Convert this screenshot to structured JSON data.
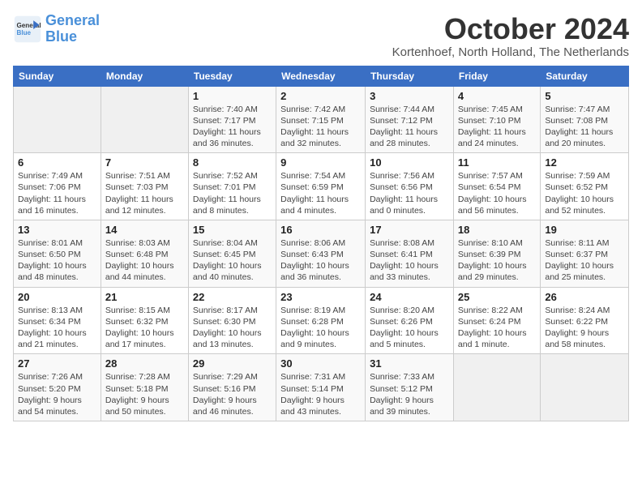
{
  "header": {
    "logo_general": "General",
    "logo_blue": "Blue",
    "month": "October 2024",
    "location": "Kortenhoef, North Holland, The Netherlands"
  },
  "days_of_week": [
    "Sunday",
    "Monday",
    "Tuesday",
    "Wednesday",
    "Thursday",
    "Friday",
    "Saturday"
  ],
  "weeks": [
    [
      {
        "day": "",
        "sunrise": "",
        "sunset": "",
        "daylight": ""
      },
      {
        "day": "",
        "sunrise": "",
        "sunset": "",
        "daylight": ""
      },
      {
        "day": "1",
        "sunrise": "Sunrise: 7:40 AM",
        "sunset": "Sunset: 7:17 PM",
        "daylight": "Daylight: 11 hours and 36 minutes."
      },
      {
        "day": "2",
        "sunrise": "Sunrise: 7:42 AM",
        "sunset": "Sunset: 7:15 PM",
        "daylight": "Daylight: 11 hours and 32 minutes."
      },
      {
        "day": "3",
        "sunrise": "Sunrise: 7:44 AM",
        "sunset": "Sunset: 7:12 PM",
        "daylight": "Daylight: 11 hours and 28 minutes."
      },
      {
        "day": "4",
        "sunrise": "Sunrise: 7:45 AM",
        "sunset": "Sunset: 7:10 PM",
        "daylight": "Daylight: 11 hours and 24 minutes."
      },
      {
        "day": "5",
        "sunrise": "Sunrise: 7:47 AM",
        "sunset": "Sunset: 7:08 PM",
        "daylight": "Daylight: 11 hours and 20 minutes."
      }
    ],
    [
      {
        "day": "6",
        "sunrise": "Sunrise: 7:49 AM",
        "sunset": "Sunset: 7:06 PM",
        "daylight": "Daylight: 11 hours and 16 minutes."
      },
      {
        "day": "7",
        "sunrise": "Sunrise: 7:51 AM",
        "sunset": "Sunset: 7:03 PM",
        "daylight": "Daylight: 11 hours and 12 minutes."
      },
      {
        "day": "8",
        "sunrise": "Sunrise: 7:52 AM",
        "sunset": "Sunset: 7:01 PM",
        "daylight": "Daylight: 11 hours and 8 minutes."
      },
      {
        "day": "9",
        "sunrise": "Sunrise: 7:54 AM",
        "sunset": "Sunset: 6:59 PM",
        "daylight": "Daylight: 11 hours and 4 minutes."
      },
      {
        "day": "10",
        "sunrise": "Sunrise: 7:56 AM",
        "sunset": "Sunset: 6:56 PM",
        "daylight": "Daylight: 11 hours and 0 minutes."
      },
      {
        "day": "11",
        "sunrise": "Sunrise: 7:57 AM",
        "sunset": "Sunset: 6:54 PM",
        "daylight": "Daylight: 10 hours and 56 minutes."
      },
      {
        "day": "12",
        "sunrise": "Sunrise: 7:59 AM",
        "sunset": "Sunset: 6:52 PM",
        "daylight": "Daylight: 10 hours and 52 minutes."
      }
    ],
    [
      {
        "day": "13",
        "sunrise": "Sunrise: 8:01 AM",
        "sunset": "Sunset: 6:50 PM",
        "daylight": "Daylight: 10 hours and 48 minutes."
      },
      {
        "day": "14",
        "sunrise": "Sunrise: 8:03 AM",
        "sunset": "Sunset: 6:48 PM",
        "daylight": "Daylight: 10 hours and 44 minutes."
      },
      {
        "day": "15",
        "sunrise": "Sunrise: 8:04 AM",
        "sunset": "Sunset: 6:45 PM",
        "daylight": "Daylight: 10 hours and 40 minutes."
      },
      {
        "day": "16",
        "sunrise": "Sunrise: 8:06 AM",
        "sunset": "Sunset: 6:43 PM",
        "daylight": "Daylight: 10 hours and 36 minutes."
      },
      {
        "day": "17",
        "sunrise": "Sunrise: 8:08 AM",
        "sunset": "Sunset: 6:41 PM",
        "daylight": "Daylight: 10 hours and 33 minutes."
      },
      {
        "day": "18",
        "sunrise": "Sunrise: 8:10 AM",
        "sunset": "Sunset: 6:39 PM",
        "daylight": "Daylight: 10 hours and 29 minutes."
      },
      {
        "day": "19",
        "sunrise": "Sunrise: 8:11 AM",
        "sunset": "Sunset: 6:37 PM",
        "daylight": "Daylight: 10 hours and 25 minutes."
      }
    ],
    [
      {
        "day": "20",
        "sunrise": "Sunrise: 8:13 AM",
        "sunset": "Sunset: 6:34 PM",
        "daylight": "Daylight: 10 hours and 21 minutes."
      },
      {
        "day": "21",
        "sunrise": "Sunrise: 8:15 AM",
        "sunset": "Sunset: 6:32 PM",
        "daylight": "Daylight: 10 hours and 17 minutes."
      },
      {
        "day": "22",
        "sunrise": "Sunrise: 8:17 AM",
        "sunset": "Sunset: 6:30 PM",
        "daylight": "Daylight: 10 hours and 13 minutes."
      },
      {
        "day": "23",
        "sunrise": "Sunrise: 8:19 AM",
        "sunset": "Sunset: 6:28 PM",
        "daylight": "Daylight: 10 hours and 9 minutes."
      },
      {
        "day": "24",
        "sunrise": "Sunrise: 8:20 AM",
        "sunset": "Sunset: 6:26 PM",
        "daylight": "Daylight: 10 hours and 5 minutes."
      },
      {
        "day": "25",
        "sunrise": "Sunrise: 8:22 AM",
        "sunset": "Sunset: 6:24 PM",
        "daylight": "Daylight: 10 hours and 1 minute."
      },
      {
        "day": "26",
        "sunrise": "Sunrise: 8:24 AM",
        "sunset": "Sunset: 6:22 PM",
        "daylight": "Daylight: 9 hours and 58 minutes."
      }
    ],
    [
      {
        "day": "27",
        "sunrise": "Sunrise: 7:26 AM",
        "sunset": "Sunset: 5:20 PM",
        "daylight": "Daylight: 9 hours and 54 minutes."
      },
      {
        "day": "28",
        "sunrise": "Sunrise: 7:28 AM",
        "sunset": "Sunset: 5:18 PM",
        "daylight": "Daylight: 9 hours and 50 minutes."
      },
      {
        "day": "29",
        "sunrise": "Sunrise: 7:29 AM",
        "sunset": "Sunset: 5:16 PM",
        "daylight": "Daylight: 9 hours and 46 minutes."
      },
      {
        "day": "30",
        "sunrise": "Sunrise: 7:31 AM",
        "sunset": "Sunset: 5:14 PM",
        "daylight": "Daylight: 9 hours and 43 minutes."
      },
      {
        "day": "31",
        "sunrise": "Sunrise: 7:33 AM",
        "sunset": "Sunset: 5:12 PM",
        "daylight": "Daylight: 9 hours and 39 minutes."
      },
      {
        "day": "",
        "sunrise": "",
        "sunset": "",
        "daylight": ""
      },
      {
        "day": "",
        "sunrise": "",
        "sunset": "",
        "daylight": ""
      }
    ]
  ]
}
